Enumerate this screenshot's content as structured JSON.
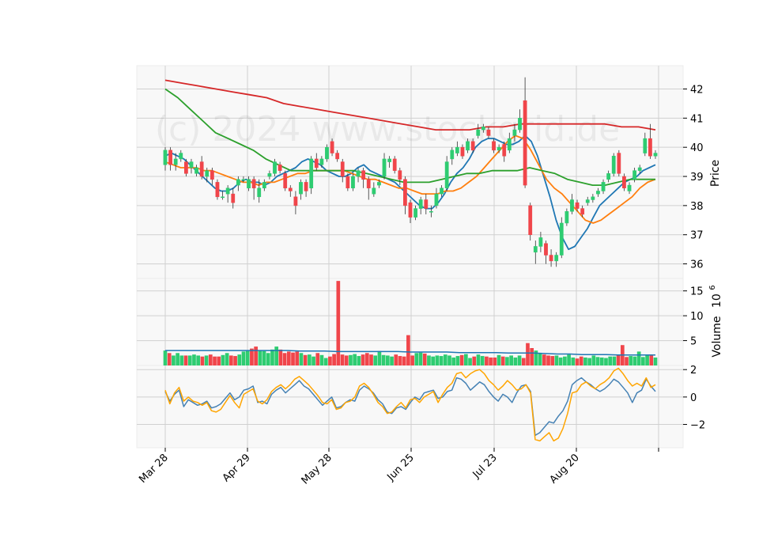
{
  "chart_data": {
    "type": "candlestick",
    "watermark": "(c) 2024 www.stockgrid.de",
    "x_tick_labels": [
      "Mar 28",
      "Apr 29",
      "May 28",
      "Jun 25",
      "Jul 23",
      "Aug 20"
    ],
    "price_panel": {
      "ylabel": "Price",
      "ylim": [
        35.5,
        42.8
      ],
      "yticks": [
        36,
        37,
        38,
        39,
        40,
        41,
        42
      ],
      "series": [
        {
          "color": "#1f77b4",
          "description": "short moving average",
          "values": [
            39.7,
            39.8,
            39.7,
            39.6,
            39.4,
            39.2,
            39.0,
            38.8,
            38.6,
            38.5,
            38.5,
            38.6,
            38.8,
            38.9,
            38.8,
            38.8,
            38.7,
            38.8,
            39.0,
            39.1,
            39.2,
            39.3,
            39.5,
            39.6,
            39.5,
            39.4,
            39.2,
            39.1,
            39.0,
            39.0,
            39.1,
            39.3,
            39.4,
            39.2,
            39.1,
            39.0,
            38.9,
            38.8,
            38.6,
            38.4,
            38.2,
            38.0,
            37.9,
            37.9,
            38.1,
            38.4,
            38.8,
            39.1,
            39.3,
            39.6,
            40.0,
            40.2,
            40.3,
            40.3,
            40.2,
            40.1,
            40.1,
            40.2,
            40.4,
            40.2,
            39.7,
            39.0,
            38.3,
            37.5,
            36.9,
            36.5,
            36.6,
            36.9,
            37.2,
            37.6,
            38.0,
            38.2,
            38.4,
            38.6,
            38.8,
            38.9,
            39.0,
            39.2,
            39.3,
            39.4
          ]
        },
        {
          "color": "#ff7f0e",
          "description": "medium moving average",
          "values": [
            39.5,
            39.4,
            39.3,
            39.3,
            39.3,
            39.2,
            39.2,
            39.1,
            39.0,
            38.9,
            38.8,
            38.8,
            38.7,
            38.8,
            38.8,
            38.9,
            39.0,
            39.1,
            39.1,
            39.2,
            39.2,
            39.2,
            39.2,
            39.2,
            39.1,
            39.0,
            38.9,
            38.9,
            38.8,
            38.7,
            38.6,
            38.6,
            38.5,
            38.4,
            38.4,
            38.4,
            38.5,
            38.5,
            38.6,
            38.8,
            39.0,
            39.3,
            39.6,
            39.9,
            40.2,
            40.4,
            40.3,
            39.9,
            39.4,
            38.9,
            38.6,
            38.4,
            38.1,
            37.8,
            37.5,
            37.4,
            37.5,
            37.7,
            37.9,
            38.1,
            38.3,
            38.6,
            38.8,
            38.9
          ]
        },
        {
          "color": "#2ca02c",
          "description": "long moving average",
          "values": [
            42.0,
            41.7,
            41.3,
            40.9,
            40.5,
            40.3,
            40.1,
            39.9,
            39.6,
            39.4,
            39.2,
            39.2,
            39.2,
            39.2,
            39.2,
            39.2,
            39.1,
            39.0,
            38.9,
            38.8,
            38.8,
            38.8,
            38.9,
            39.0,
            39.1,
            39.1,
            39.2,
            39.2,
            39.2,
            39.3,
            39.2,
            39.1,
            38.9,
            38.8,
            38.7,
            38.7,
            38.8,
            38.9,
            38.9,
            38.9
          ]
        },
        {
          "color": "#d62728",
          "description": "longest moving average",
          "values": [
            42.3,
            42.2,
            42.1,
            42.0,
            41.9,
            41.8,
            41.7,
            41.5,
            41.4,
            41.3,
            41.2,
            41.1,
            41.0,
            40.9,
            40.8,
            40.7,
            40.6,
            40.6,
            40.6,
            40.7,
            40.7,
            40.8,
            40.8,
            40.8,
            40.8,
            40.8,
            40.8,
            40.7,
            40.7,
            40.6
          ]
        }
      ],
      "candles": [
        [
          39.4,
          39.9,
          40.0,
          39.2
        ],
        [
          39.9,
          39.4,
          40.0,
          39.2
        ],
        [
          39.4,
          39.6,
          39.8,
          39.2
        ],
        [
          39.6,
          39.8,
          39.9,
          39.5
        ],
        [
          39.5,
          39.1,
          39.6,
          39.0
        ],
        [
          39.3,
          39.5,
          39.6,
          39.1
        ],
        [
          39.1,
          39.3,
          39.4,
          39.0
        ],
        [
          39.5,
          39.0,
          39.7,
          38.9
        ],
        [
          39.0,
          39.2,
          39.3,
          38.8
        ],
        [
          39.2,
          38.9,
          39.3,
          38.7
        ],
        [
          38.8,
          38.3,
          38.9,
          38.2
        ],
        [
          38.3,
          38.3,
          38.5,
          38.2
        ],
        [
          38.4,
          38.6,
          38.7,
          38.1
        ],
        [
          38.4,
          38.1,
          38.6,
          37.9
        ],
        [
          38.7,
          38.9,
          39.0,
          38.5
        ],
        [
          38.9,
          38.9,
          39.0,
          38.8
        ],
        [
          38.6,
          38.9,
          39.0,
          38.5
        ],
        [
          38.9,
          38.6,
          39.0,
          38.2
        ],
        [
          38.3,
          38.6,
          38.9,
          38.1
        ],
        [
          38.6,
          38.8,
          38.9,
          38.5
        ],
        [
          39.0,
          39.1,
          39.2,
          38.9
        ],
        [
          39.1,
          39.5,
          39.6,
          39.0
        ],
        [
          39.4,
          39.2,
          39.5,
          39.1
        ],
        [
          39.1,
          38.6,
          39.2,
          38.5
        ],
        [
          38.6,
          38.5,
          38.7,
          38.3
        ],
        [
          38.3,
          38.0,
          38.5,
          37.7
        ],
        [
          38.4,
          38.8,
          38.9,
          38.2
        ],
        [
          38.8,
          38.5,
          38.9,
          38.3
        ],
        [
          38.6,
          39.6,
          39.7,
          38.4
        ],
        [
          39.6,
          39.3,
          39.8,
          39.2
        ],
        [
          39.4,
          39.6,
          39.7,
          39.3
        ],
        [
          39.6,
          40.0,
          40.1,
          39.5
        ],
        [
          40.2,
          39.8,
          40.3,
          39.7
        ],
        [
          39.8,
          39.6,
          39.9,
          39.5
        ],
        [
          39.5,
          39.0,
          39.6,
          38.8
        ],
        [
          39.0,
          38.6,
          39.1,
          38.5
        ],
        [
          38.6,
          39.0,
          39.1,
          38.5
        ],
        [
          39.0,
          39.2,
          39.3,
          38.8
        ],
        [
          39.2,
          38.9,
          39.3,
          38.6
        ],
        [
          38.9,
          38.6,
          39.0,
          38.2
        ],
        [
          38.4,
          38.6,
          38.8,
          38.3
        ],
        [
          38.7,
          38.8,
          38.9,
          38.6
        ],
        [
          39.0,
          39.6,
          39.8,
          38.9
        ],
        [
          39.5,
          39.6,
          39.7,
          39.3
        ],
        [
          39.6,
          39.2,
          39.7,
          39.1
        ],
        [
          39.2,
          38.9,
          39.3,
          38.7
        ],
        [
          38.9,
          38.0,
          39.0,
          37.7
        ],
        [
          38.1,
          37.6,
          38.2,
          37.4
        ],
        [
          37.6,
          37.9,
          38.0,
          37.5
        ],
        [
          37.9,
          38.2,
          38.3,
          37.7
        ],
        [
          38.2,
          37.9,
          38.4,
          37.7
        ],
        [
          37.8,
          37.8,
          38.0,
          37.6
        ],
        [
          38.0,
          38.4,
          38.6,
          37.9
        ],
        [
          38.4,
          38.6,
          38.7,
          38.3
        ],
        [
          38.6,
          39.5,
          39.7,
          38.5
        ],
        [
          39.6,
          39.9,
          40.0,
          39.4
        ],
        [
          39.8,
          40.0,
          40.2,
          39.7
        ],
        [
          40.0,
          39.7,
          40.1,
          39.6
        ],
        [
          39.9,
          40.2,
          40.3,
          39.8
        ],
        [
          40.2,
          39.9,
          40.3,
          39.8
        ],
        [
          40.4,
          40.6,
          40.8,
          40.3
        ],
        [
          40.6,
          40.7,
          40.8,
          40.5
        ],
        [
          40.6,
          40.4,
          40.7,
          40.3
        ],
        [
          40.2,
          39.9,
          40.3,
          39.8
        ],
        [
          39.9,
          40.0,
          40.1,
          39.8
        ],
        [
          40.1,
          39.7,
          40.2,
          39.5
        ],
        [
          39.9,
          40.3,
          40.5,
          39.8
        ],
        [
          40.4,
          40.6,
          40.8,
          40.2
        ],
        [
          40.6,
          41.0,
          41.3,
          40.5
        ],
        [
          41.6,
          38.7,
          42.4,
          38.6
        ],
        [
          38.0,
          37.0,
          38.1,
          36.8
        ],
        [
          36.4,
          36.6,
          36.8,
          36.0
        ],
        [
          36.6,
          36.9,
          37.1,
          36.4
        ],
        [
          36.7,
          36.3,
          36.8,
          36.0
        ],
        [
          36.3,
          36.1,
          36.5,
          35.9
        ],
        [
          36.1,
          36.3,
          36.4,
          35.9
        ],
        [
          36.3,
          37.4,
          37.6,
          36.2
        ],
        [
          37.4,
          37.8,
          37.9,
          37.3
        ],
        [
          37.8,
          38.2,
          38.4,
          37.7
        ],
        [
          38.1,
          37.9,
          38.2,
          37.8
        ],
        [
          37.9,
          37.7,
          38.0,
          37.6
        ],
        [
          38.1,
          38.2,
          38.3,
          38.0
        ],
        [
          38.2,
          38.3,
          38.4,
          38.1
        ],
        [
          38.4,
          38.5,
          38.6,
          38.3
        ],
        [
          38.5,
          38.8,
          38.9,
          38.4
        ],
        [
          38.9,
          39.1,
          39.2,
          38.8
        ],
        [
          39.1,
          39.7,
          39.8,
          39.0
        ],
        [
          39.8,
          39.1,
          39.9,
          39.0
        ],
        [
          39.0,
          38.6,
          39.1,
          38.5
        ],
        [
          38.5,
          38.7,
          38.8,
          38.4
        ],
        [
          38.9,
          39.2,
          39.3,
          38.8
        ],
        [
          39.2,
          39.3,
          39.4,
          39.1
        ],
        [
          39.8,
          40.3,
          40.5,
          39.7
        ],
        [
          40.3,
          39.7,
          40.8,
          39.6
        ],
        [
          39.7,
          39.8,
          39.9,
          39.6
        ]
      ]
    },
    "volume_panel": {
      "ylabel": "Volume",
      "unit": "10^6",
      "ylim": [
        0,
        17.5
      ],
      "yticks": [
        5,
        10,
        15
      ],
      "avg_color": "#1f77b4",
      "values": [
        3.0,
        2.5,
        2.0,
        2.5,
        2.0,
        2.0,
        2.0,
        2.2,
        2.0,
        1.8,
        2.0,
        2.2,
        1.8,
        1.8,
        2.1,
        2.5,
        2.0,
        1.9,
        2.2,
        2.8,
        3.0,
        3.4,
        3.8,
        3.1,
        2.9,
        2.5,
        3.2,
        3.8,
        3.2,
        2.5,
        2.8,
        2.6,
        2.8,
        2.5,
        2.1,
        2.2,
        1.8,
        2.5,
        2.1,
        1.5,
        1.8,
        2.3,
        17.0,
        2.2,
        2.0,
        2.1,
        2.3,
        1.9,
        2.2,
        2.5,
        2.2,
        2.0,
        2.9,
        2.1,
        2.0,
        1.8,
        2.2,
        1.9,
        1.8,
        6.1,
        2.0,
        2.5,
        2.6,
        2.4,
        2.0,
        1.8,
        2.0,
        1.9,
        2.2,
        2.0,
        1.6,
        1.9,
        2.1,
        2.3,
        1.5,
        1.8,
        2.2,
        1.9,
        1.8,
        1.6,
        1.6,
        2.1,
        1.8,
        1.7,
        2.0,
        1.6,
        2.0,
        1.5,
        4.5,
        3.5,
        3.0,
        2.5,
        2.2,
        2.0,
        1.9,
        2.0,
        1.6,
        1.8,
        2.2,
        1.6,
        1.4,
        1.8,
        1.6,
        1.5,
        2.0,
        1.7,
        1.6,
        1.5,
        1.8,
        1.8,
        2.1,
        4.1,
        1.7,
        1.9,
        1.8,
        2.8,
        1.7,
        2.2,
        2.0,
        1.6
      ],
      "avg_values": [
        3.0,
        3.0,
        3.0,
        3.0,
        3.0,
        3.0,
        3.0,
        3.0,
        3.0,
        3.0,
        3.0,
        2.9,
        2.9,
        2.9,
        2.8,
        2.8,
        2.8,
        2.8,
        2.8,
        2.8,
        2.7,
        2.7,
        2.7,
        2.7,
        2.6,
        2.6,
        2.6,
        2.6,
        2.5,
        2.5,
        2.5,
        2.4,
        2.3,
        2.3,
        2.2,
        2.2,
        2.2,
        2.1,
        2.1,
        2.1,
        2.1
      ]
    },
    "oscillator_panel": {
      "ylim": [
        -3.7,
        2.3
      ],
      "yticks": [
        -2,
        0,
        2
      ],
      "series": [
        {
          "color": "#4682b4",
          "values": [
            0.4,
            -0.3,
            0.2,
            0.5,
            -0.7,
            -0.2,
            -0.4,
            -0.6,
            -0.5,
            -0.3,
            -0.8,
            -0.7,
            -0.5,
            -0.1,
            0.3,
            -0.2,
            0.0,
            0.5,
            0.6,
            0.8,
            -0.4,
            -0.3,
            -0.5,
            0.2,
            0.5,
            0.7,
            0.3,
            0.6,
            0.9,
            1.2,
            0.8,
            0.6,
            0.2,
            -0.2,
            -0.6,
            -0.3,
            0.0,
            -0.8,
            -0.7,
            -0.4,
            -0.2,
            -0.3,
            0.5,
            0.8,
            0.6,
            0.3,
            -0.2,
            -0.5,
            -1.1,
            -1.2,
            -0.8,
            -0.7,
            -0.9,
            -0.4,
            0.0,
            -0.2,
            0.3,
            0.4,
            0.5,
            -0.1,
            0.0,
            0.4,
            0.5,
            1.4,
            1.3,
            1.0,
            0.5,
            0.8,
            1.1,
            0.9,
            0.4,
            0.0,
            -0.3,
            0.2,
            0.0,
            -0.4,
            0.3,
            0.8,
            0.9,
            0.4,
            -2.8,
            -2.6,
            -2.2,
            -1.8,
            -1.9,
            -1.4,
            -1.0,
            -0.3,
            0.9,
            1.2,
            1.4,
            1.1,
            0.9,
            0.6,
            0.4,
            0.6,
            0.9,
            1.3,
            1.1,
            0.7,
            0.3,
            -0.4,
            0.3,
            0.5,
            1.3,
            0.8,
            0.4
          ]
        },
        {
          "color": "#ffa500",
          "values": [
            0.5,
            -0.5,
            0.3,
            0.7,
            -0.3,
            0.0,
            -0.3,
            -0.4,
            -0.6,
            -0.4,
            -1.0,
            -1.1,
            -0.9,
            -0.4,
            0.1,
            -0.4,
            -0.8,
            0.2,
            0.4,
            0.6,
            -0.3,
            -0.5,
            -0.2,
            0.4,
            0.7,
            0.9,
            0.6,
            0.9,
            1.3,
            1.5,
            1.2,
            0.9,
            0.5,
            0.1,
            -0.4,
            -0.5,
            -0.2,
            -0.9,
            -0.8,
            -0.4,
            -0.3,
            0.0,
            0.8,
            1.0,
            0.7,
            0.2,
            -0.4,
            -0.7,
            -1.2,
            -1.1,
            -0.7,
            -0.4,
            -0.8,
            -0.2,
            -0.1,
            -0.4,
            0.0,
            0.2,
            0.4,
            -0.4,
            0.2,
            0.7,
            1.0,
            1.7,
            1.8,
            1.4,
            1.7,
            1.9,
            2.0,
            1.7,
            1.2,
            0.9,
            0.5,
            0.8,
            1.2,
            0.9,
            0.5,
            0.6,
            0.9,
            0.3,
            -3.1,
            -3.2,
            -2.9,
            -2.6,
            -3.2,
            -3.0,
            -2.3,
            -1.2,
            0.3,
            0.4,
            0.9,
            1.1,
            0.8,
            0.6,
            0.9,
            1.1,
            1.4,
            1.9,
            2.1,
            1.7,
            1.2,
            0.8,
            1.0,
            0.8,
            1.4,
            0.7,
            0.9
          ]
        }
      ]
    }
  }
}
